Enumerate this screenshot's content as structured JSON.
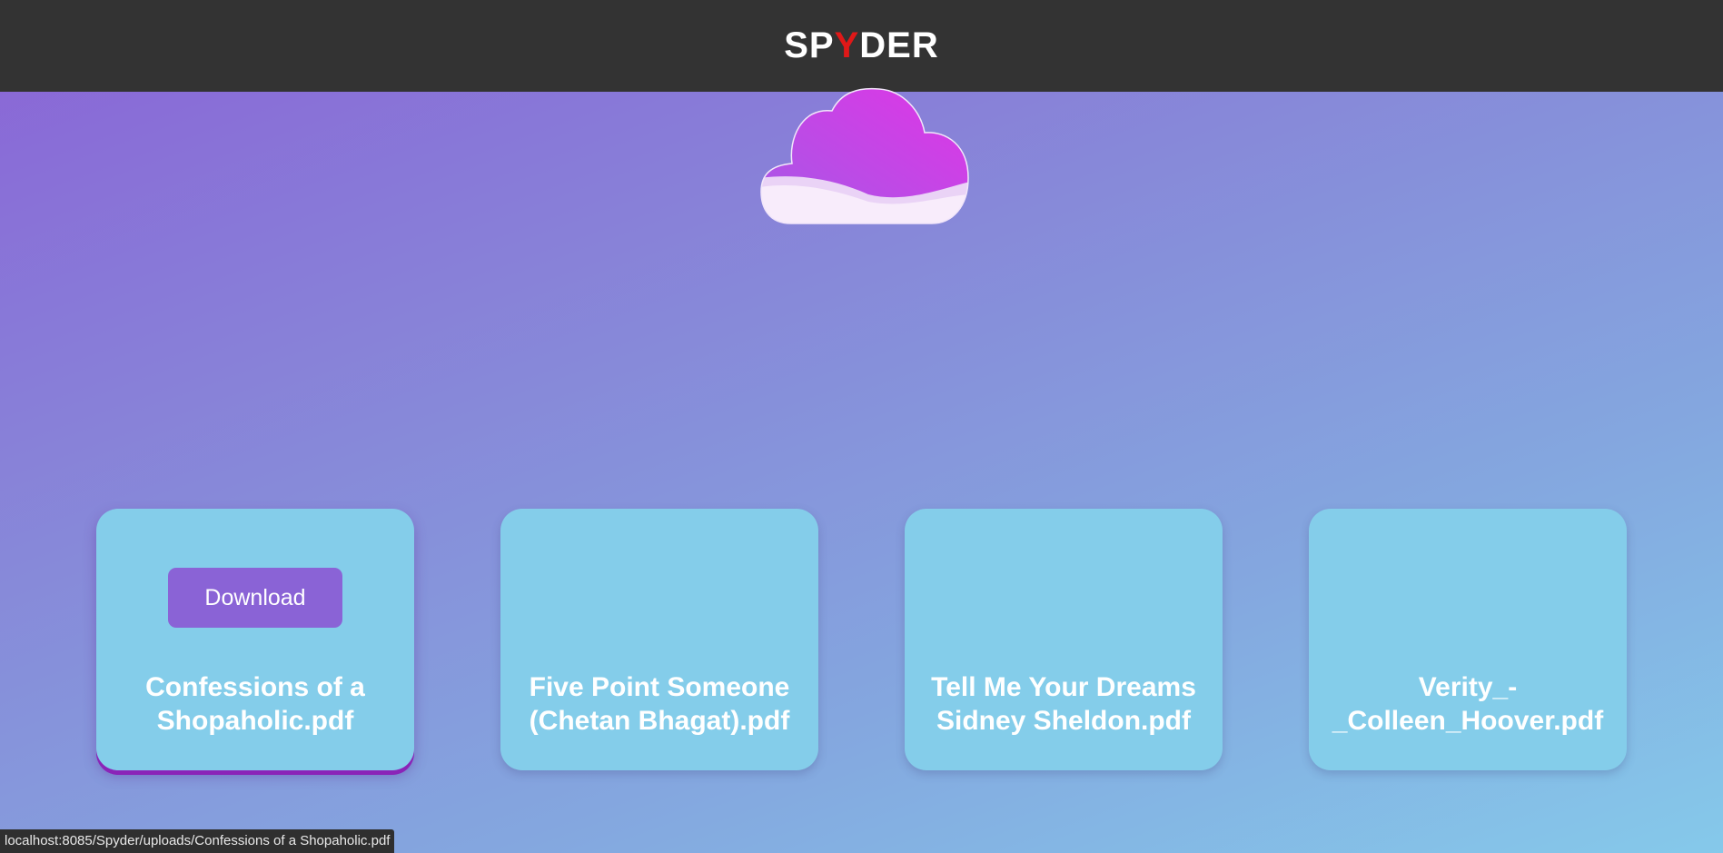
{
  "header": {
    "brand_prefix": "SP",
    "brand_highlight": "Y",
    "brand_suffix": "DER"
  },
  "files": [
    {
      "name": "Confessions of a Shopaholic.pdf",
      "download_label": "Download"
    },
    {
      "name": "Five Point Someone (Chetan Bhagat).pdf"
    },
    {
      "name": "Tell Me Your Dreams Sidney Sheldon.pdf"
    },
    {
      "name": "Verity_-_Colleen_Hoover.pdf"
    }
  ],
  "status_bar": {
    "url": "localhost:8085/Spyder/uploads/Confessions of a Shopaholic.pdf"
  },
  "colors": {
    "header_bg": "#333333",
    "brand_accent": "#e01818",
    "card_bg": "#84cdea",
    "button_bg": "#8a63d6"
  },
  "icons": {
    "logo": "cloud-icon"
  }
}
